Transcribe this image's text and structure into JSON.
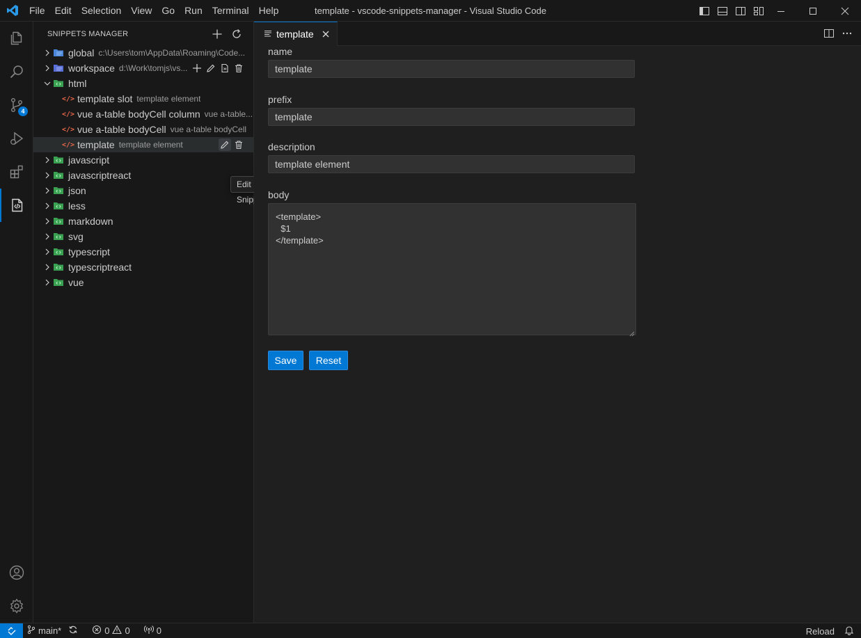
{
  "window": {
    "title": "template - vscode-snippets-manager - Visual Studio Code",
    "menu": [
      "File",
      "Edit",
      "Selection",
      "View",
      "Go",
      "Run",
      "Terminal",
      "Help"
    ]
  },
  "activity_bar": {
    "items": [
      "explorer-icon",
      "search-icon",
      "source-control-icon",
      "run-debug-icon",
      "extensions-icon",
      "snippets-manager-icon"
    ],
    "source_control_badge": "4",
    "bottom_items": [
      "account-icon",
      "manage-gear-icon"
    ]
  },
  "sidebar": {
    "title": "SNIPPETS MANAGER",
    "tree": [
      {
        "label": "global",
        "desc": "c:\\Users\\tom\\AppData\\Roaming\\Code..."
      },
      {
        "label": "workspace",
        "desc": "d:\\Work\\tomjs\\vs..."
      },
      {
        "label": "html",
        "desc": ""
      },
      {
        "label": "template slot",
        "desc": "template element"
      },
      {
        "label": "vue a-table bodyCell column",
        "desc": "vue a-table..."
      },
      {
        "label": "vue a-table bodyCell",
        "desc": "vue a-table bodyCell"
      },
      {
        "label": "template",
        "desc": "template element"
      },
      {
        "label": "javascript",
        "desc": ""
      },
      {
        "label": "javascriptreact",
        "desc": ""
      },
      {
        "label": "json",
        "desc": ""
      },
      {
        "label": "less",
        "desc": ""
      },
      {
        "label": "markdown",
        "desc": ""
      },
      {
        "label": "svg",
        "desc": ""
      },
      {
        "label": "typescript",
        "desc": ""
      },
      {
        "label": "typescriptreact",
        "desc": ""
      },
      {
        "label": "vue",
        "desc": ""
      }
    ],
    "tooltip": "Edit Snippet"
  },
  "editor": {
    "tab_label": "template",
    "fields": {
      "name_label": "name",
      "name_value": "template",
      "prefix_label": "prefix",
      "prefix_value": "template",
      "description_label": "description",
      "description_value": "template element",
      "body_label": "body",
      "body_value": "<template>\n  $1\n</template>"
    },
    "save_label": "Save",
    "reset_label": "Reset"
  },
  "statusbar": {
    "branch": "main*",
    "errors": "0",
    "warnings": "0",
    "ports": "0",
    "reload_label": "Reload"
  },
  "colors": {
    "accent": "#0078d4",
    "snippet_icon": "#e8674a",
    "folder_icon": "#3aa052"
  }
}
